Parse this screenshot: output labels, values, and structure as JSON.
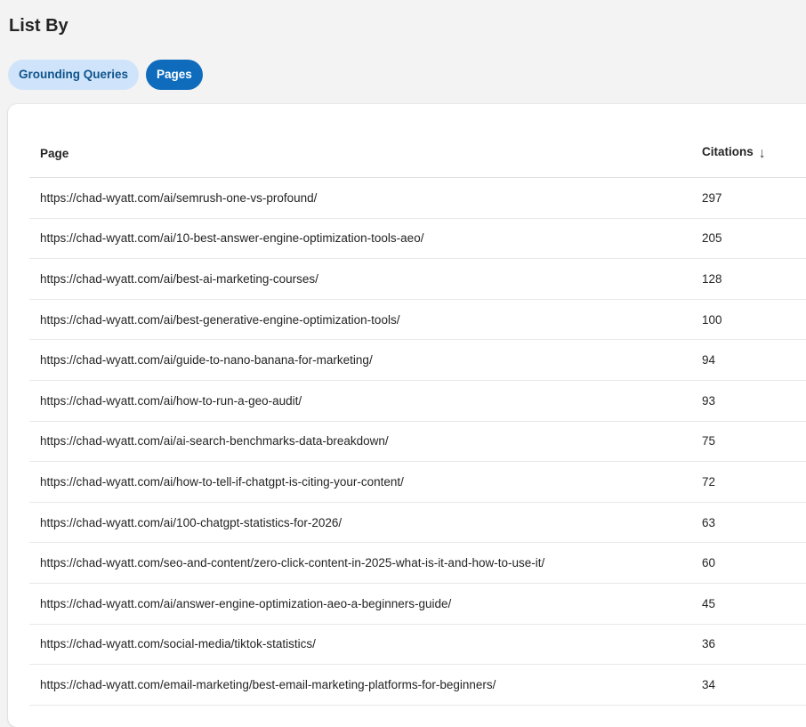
{
  "header": {
    "title": "List By"
  },
  "filters": {
    "options": [
      {
        "label": "Grounding Queries",
        "active": false
      },
      {
        "label": "Pages",
        "active": true
      }
    ]
  },
  "table": {
    "columns": {
      "page": "Page",
      "citations": "Citations"
    },
    "sort_icon": "arrow-down-icon",
    "rows": [
      {
        "page": "https://chad-wyatt.com/ai/semrush-one-vs-profound/",
        "citations": "297"
      },
      {
        "page": "https://chad-wyatt.com/ai/10-best-answer-engine-optimization-tools-aeo/",
        "citations": "205"
      },
      {
        "page": "https://chad-wyatt.com/ai/best-ai-marketing-courses/",
        "citations": "128"
      },
      {
        "page": "https://chad-wyatt.com/ai/best-generative-engine-optimization-tools/",
        "citations": "100"
      },
      {
        "page": "https://chad-wyatt.com/ai/guide-to-nano-banana-for-marketing/",
        "citations": "94"
      },
      {
        "page": "https://chad-wyatt.com/ai/how-to-run-a-geo-audit/",
        "citations": "93"
      },
      {
        "page": "https://chad-wyatt.com/ai/ai-search-benchmarks-data-breakdown/",
        "citations": "75"
      },
      {
        "page": "https://chad-wyatt.com/ai/how-to-tell-if-chatgpt-is-citing-your-content/",
        "citations": "72"
      },
      {
        "page": "https://chad-wyatt.com/ai/100-chatgpt-statistics-for-2026/",
        "citations": "63"
      },
      {
        "page": "https://chad-wyatt.com/seo-and-content/zero-click-content-in-2025-what-is-it-and-how-to-use-it/",
        "citations": "60"
      },
      {
        "page": "https://chad-wyatt.com/ai/answer-engine-optimization-aeo-a-beginners-guide/",
        "citations": "45"
      },
      {
        "page": "https://chad-wyatt.com/social-media/tiktok-statistics/",
        "citations": "36"
      },
      {
        "page": "https://chad-wyatt.com/email-marketing/best-email-marketing-platforms-for-beginners/",
        "citations": "34"
      }
    ]
  },
  "colors": {
    "accent": "#0f6cbd",
    "pill_inactive_bg": "#cfe4fa",
    "background": "#f3f3f3"
  }
}
